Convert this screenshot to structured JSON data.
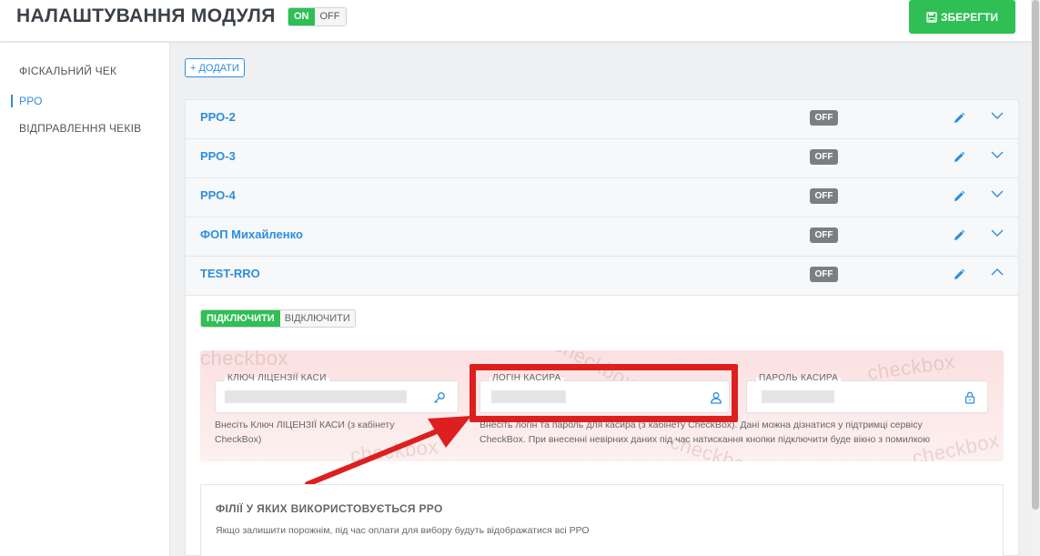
{
  "header": {
    "title": "НАЛАШТУВАННЯ МОДУЛЯ",
    "toggle_on": "ON",
    "toggle_off": "OFF",
    "save_label": "ЗБЕРЕГТИ"
  },
  "sidebar": {
    "items": [
      {
        "label": "ФІСКАЛЬНИЙ ЧЕК",
        "active": false
      },
      {
        "label": "РРО",
        "active": true
      },
      {
        "label": "ВІДПРАВЛЕННЯ ЧЕКІВ",
        "active": false
      }
    ]
  },
  "main": {
    "add_label": "+ ДОДАТИ",
    "accordion": [
      {
        "title": "РРО-2",
        "status": "OFF",
        "expanded": false
      },
      {
        "title": "РРО-3",
        "status": "OFF",
        "expanded": false
      },
      {
        "title": "РРО-4",
        "status": "OFF",
        "expanded": false
      },
      {
        "title": "ФОП Михайленко",
        "status": "OFF",
        "expanded": false
      },
      {
        "title": "TEST-RRO",
        "status": "OFF",
        "expanded": true
      }
    ],
    "connection": {
      "connect_label": "ПІДКЛЮЧИТИ",
      "disconnect_label": "ВІДКЛЮЧИТИ"
    },
    "credentials": {
      "watermark": "checkbox",
      "license_key": {
        "label": "КЛЮЧ ЛІЦЕНЗІЇ КАСИ",
        "icon": "key-icon",
        "hint_line1": "Внесіть Ключ ЛІЦЕНЗІЇ КАСИ (з кабінету",
        "hint_line2": "CheckBox)"
      },
      "login": {
        "label": "ЛОГІН КАСИРА",
        "icon": "user-icon"
      },
      "password": {
        "label": "ПАРОЛЬ КАСИРА",
        "icon": "lock-icon"
      },
      "cashier_hint_line1": "Внесіть логін та пароль для касира (з кабінету CheckBox). Дані можна дізнатися у підтримці сервісу",
      "cashier_hint_line2": "CheckBox. При внесенні невірних даних під час натискання кнопки підключити буде вікно з помилкою"
    },
    "branches": {
      "title": "ФІЛІЇ У ЯКИХ ВИКОРИСТОВУЄТЬСЯ РРО",
      "hint": "Якщо залишити порожнім, під час оплати для вибору будуть відображатися всі РРО"
    }
  },
  "colors": {
    "accent_blue": "#2c8ee0",
    "success_green": "#2fbf55",
    "badge_gray": "#7a7f84",
    "highlight_red": "#dd1f1f"
  }
}
